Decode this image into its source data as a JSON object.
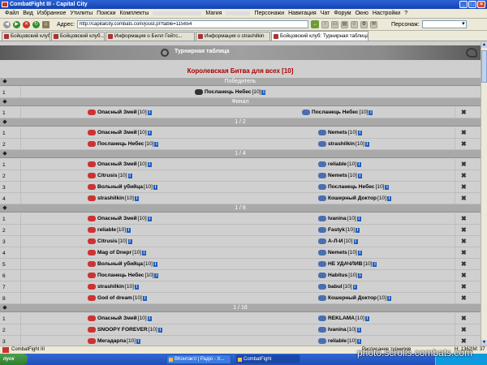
{
  "window": {
    "title": "CombatFight III - Capital City"
  },
  "menu": [
    "Файл",
    "Вид",
    "Избранное",
    "Утилиты",
    "Поиски",
    "Комплекты",
    "",
    "",
    "Магия",
    "",
    "Персонажи",
    "Навигация",
    "Чат",
    "Форум",
    "Окно",
    "Настройки",
    "?"
  ],
  "toolbar": {
    "address_label": "Адрес:",
    "address_value": "http://capitalcity.combats.com/joust.pl?table=115654",
    "persona_label": "Персонаж:",
    "persona_value": ""
  },
  "tabs": [
    "Бойцовский клуб",
    "Бойцовский клуб...",
    "Информация о Билл Гейтс...",
    "Информация о strashilkin",
    "Бойцовский клуб: Турнирная таблица"
  ],
  "page": {
    "banner_title": "Турнирная таблица",
    "tournament_title": "Королевская Битва для всех [10]",
    "sections": {
      "winner": "Победитель",
      "final": "Финал",
      "r2": "1 / 2",
      "r4": "1 / 4",
      "r8": "1 / 8",
      "r16": "1 / 16"
    },
    "winner_row": {
      "num": "1",
      "name": "Посланець Небес",
      "lvl": "[10]"
    },
    "final_row": {
      "num": "1",
      "left": "Опасный Змей",
      "left_lvl": "[10]",
      "right": "Посланець Небес",
      "right_lvl": "[10]"
    },
    "r2": [
      {
        "num": "1",
        "left": "Опасный Змей",
        "left_lvl": "[10]",
        "right": "Nemets",
        "right_lvl": "[10]"
      },
      {
        "num": "2",
        "left": "Посланець Небес",
        "left_lvl": "[10]",
        "right": "strashilkin",
        "right_lvl": "[10]"
      }
    ],
    "r4": [
      {
        "num": "1",
        "left": "Опасный Змей",
        "left_lvl": "[10]",
        "right": "reliable",
        "right_lvl": "[10]"
      },
      {
        "num": "2",
        "left": "Citrusis",
        "left_lvl": "[10]",
        "right": "Nemets",
        "right_lvl": "[10]"
      },
      {
        "num": "3",
        "left": "Вольный убийца",
        "left_lvl": "[10]",
        "right": "Посланець Небес",
        "right_lvl": "[10]"
      },
      {
        "num": "4",
        "left": "strashilkin",
        "left_lvl": "[10]",
        "right": "Кошерный Доктор",
        "right_lvl": "[10]"
      }
    ],
    "r8": [
      {
        "num": "1",
        "left": "Опасный Змей",
        "left_lvl": "[10]",
        "right": "Ivanina",
        "right_lvl": "[10]"
      },
      {
        "num": "2",
        "left": "reliable",
        "left_lvl": "[10]",
        "right": "Fastyk",
        "right_lvl": "[10]"
      },
      {
        "num": "3",
        "left": "Citrusis",
        "left_lvl": "[10]",
        "right": "А-Л-И",
        "right_lvl": "[10]"
      },
      {
        "num": "4",
        "left": "Mag of Dnepr",
        "left_lvl": "[10]",
        "right": "Nemets",
        "right_lvl": "[10]"
      },
      {
        "num": "5",
        "left": "Вольный убийца",
        "left_lvl": "[10]",
        "right": "НЕ УДАЧЛИВ",
        "right_lvl": "[10]"
      },
      {
        "num": "6",
        "left": "Посланець Небес",
        "left_lvl": "[10]",
        "right": "Habitus",
        "right_lvl": "[10]"
      },
      {
        "num": "7",
        "left": "strashilkin",
        "left_lvl": "[10]",
        "right": "babul",
        "right_lvl": "[10]"
      },
      {
        "num": "8",
        "left": "God of dream",
        "left_lvl": "[10]",
        "right": "Кошерный Доктор",
        "right_lvl": "[10]"
      }
    ],
    "r16": [
      {
        "num": "1",
        "left": "Опасный Змей",
        "left_lvl": "[10]",
        "right": "REKLAMA",
        "right_lvl": "[10]"
      },
      {
        "num": "2",
        "left": "SNOOPY FOREVER",
        "left_lvl": "[10]",
        "right": "Ivanina",
        "right_lvl": "[10]"
      },
      {
        "num": "3",
        "left": "Мегадарла",
        "left_lvl": "[10]",
        "right": "reliable",
        "right_lvl": "[10]"
      }
    ]
  },
  "statusbar": {
    "left": "CombatFight III",
    "mid": "Расписание турниров",
    "right": "Н: 1362|М: 37"
  },
  "taskbar": {
    "start": "пуск",
    "tasks": [
      "ВКонтакті | Радіо - Х...",
      "CombatFight"
    ]
  },
  "watermark": "photo.scrolls.combats.com"
}
